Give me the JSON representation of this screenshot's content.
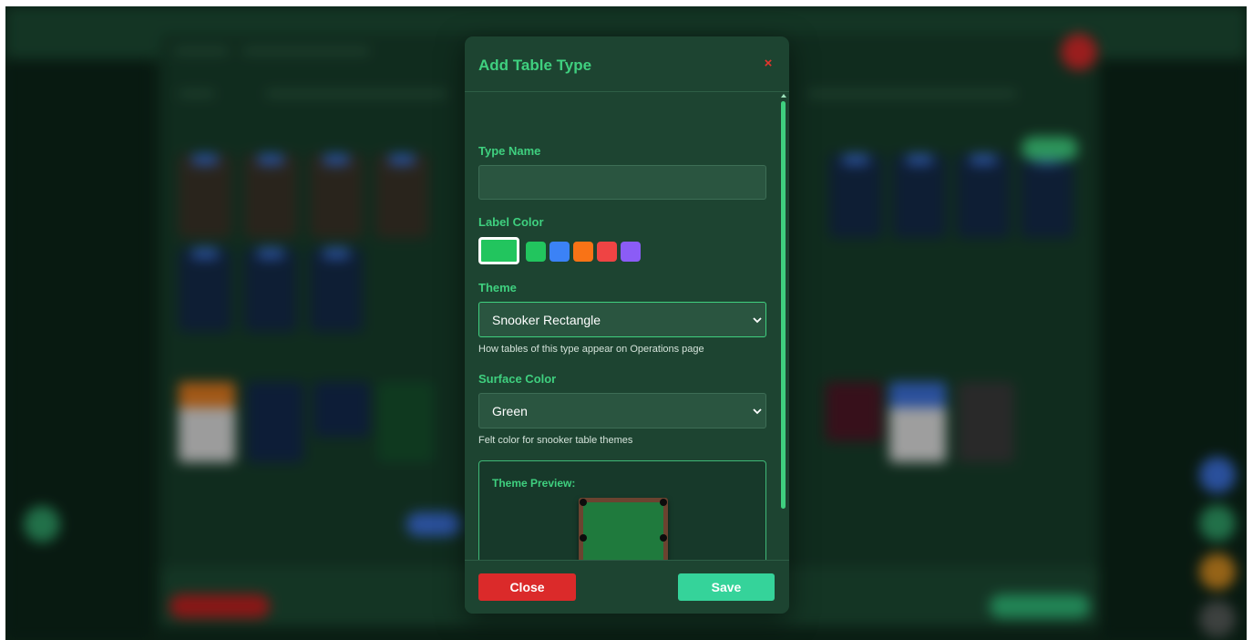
{
  "modal": {
    "title": "Add Table Type",
    "close_icon": "×",
    "fields": {
      "type_name": {
        "label": "Type Name",
        "value": "",
        "placeholder": ""
      },
      "label_color": {
        "label": "Label Color",
        "selected": "#22c55e",
        "options": [
          "#22c55e",
          "#3b82f6",
          "#f97316",
          "#ef4444",
          "#8b5cf6"
        ]
      },
      "theme": {
        "label": "Theme",
        "selected": "Snooker Rectangle",
        "help": "How tables of this type appear on Operations page"
      },
      "surface_color": {
        "label": "Surface Color",
        "selected": "Green",
        "help": "Felt color for snooker table themes"
      }
    },
    "preview": {
      "label": "Theme Preview:",
      "felt_color": "#1f7a3d",
      "rail_color": "#6b4330"
    },
    "footer": {
      "close_label": "Close",
      "save_label": "Save"
    }
  },
  "colors": {
    "accent": "#3fd07f",
    "modal_bg": "#1d4431",
    "danger": "#db2a2a",
    "save": "#35d39a"
  },
  "icons": [
    "close-icon",
    "chevron-down-icon",
    "scroll-up-icon",
    "scroll-down-icon"
  ]
}
